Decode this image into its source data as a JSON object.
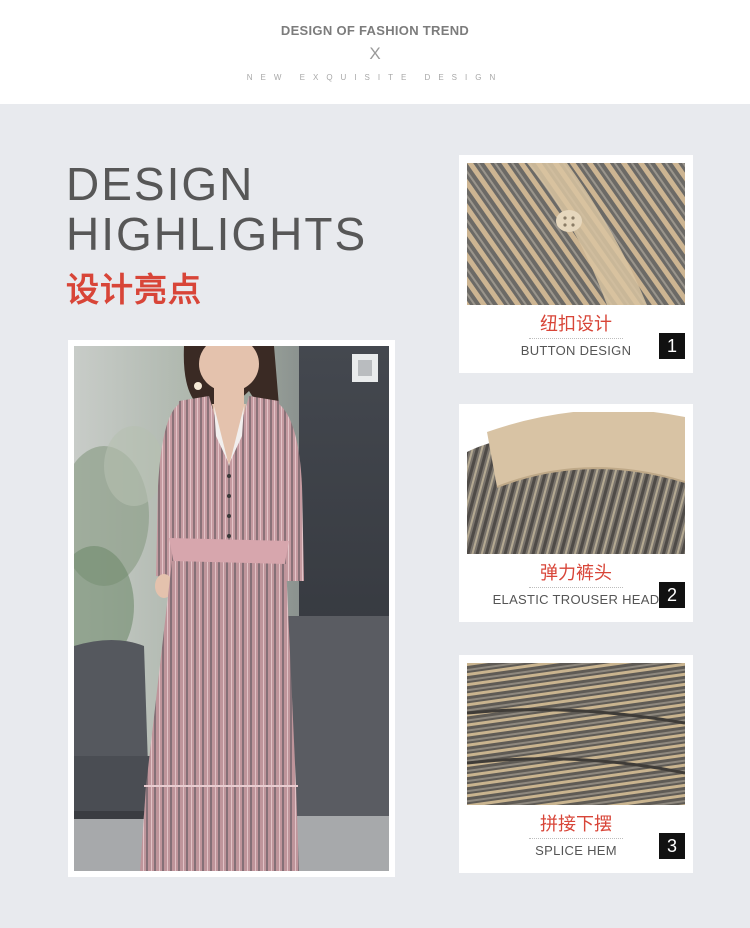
{
  "header": {
    "title": "DESIGN OF FASHION TREND",
    "divider_mark": "X",
    "subtitle": "NEW EXQUISITE DESIGN"
  },
  "highlights": {
    "line1": "DESIGN",
    "line2": "HIGHLIGHTS",
    "cn": "设计亮点"
  },
  "details": [
    {
      "cn": "纽扣设计",
      "en": "BUTTON DESIGN",
      "num": "1"
    },
    {
      "cn": "弹力裤头",
      "en": "ELASTIC TROUSER HEAD",
      "num": "2"
    },
    {
      "cn": "拼接下摆",
      "en": "SPLICE HEM",
      "num": "3"
    }
  ],
  "colors": {
    "accent_red": "#d84538",
    "heading_gray": "#575757",
    "background": "#e8eaee"
  }
}
